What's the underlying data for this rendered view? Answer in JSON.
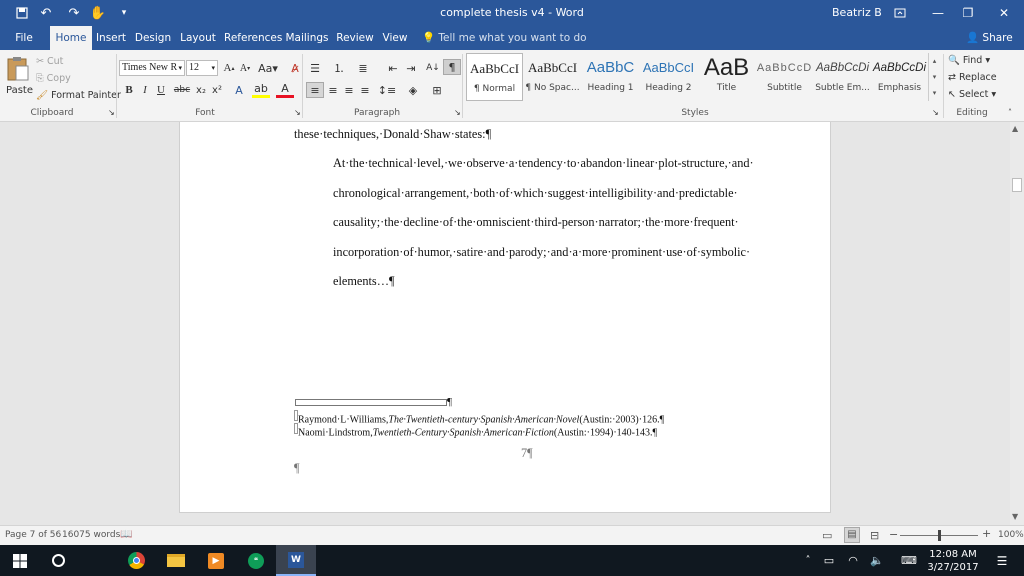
{
  "window": {
    "title": "complete thesis v4  -  Word",
    "user": "Beatriz B"
  },
  "tabs": [
    "File",
    "Home",
    "Insert",
    "Design",
    "Layout",
    "References",
    "Mailings",
    "Review",
    "View"
  ],
  "tell_me": "Tell me what you want to do",
  "share": "Share",
  "clipboard": {
    "paste": "Paste",
    "cut": "Cut",
    "copy": "Copy",
    "format_painter": "Format Painter",
    "label": "Clipboard"
  },
  "font": {
    "name": "Times New R",
    "size": "12",
    "label": "Font"
  },
  "paragraph": {
    "label": "Paragraph"
  },
  "styles": {
    "label": "Styles",
    "items": [
      {
        "preview": "AaBbCcI",
        "name": "¶ Normal"
      },
      {
        "preview": "AaBbCcI",
        "name": "¶ No Spac..."
      },
      {
        "preview": "AaBbC",
        "name": "Heading 1"
      },
      {
        "preview": "AaBbCcI",
        "name": "Heading 2"
      },
      {
        "preview": "AaB",
        "name": "Title"
      },
      {
        "preview": "AaBbCcD",
        "name": "Subtitle"
      },
      {
        "preview": "AaBbCcDi",
        "name": "Subtle Em..."
      },
      {
        "preview": "AaBbCcDi",
        "name": "Emphasis"
      }
    ]
  },
  "editing": {
    "find": "Find",
    "replace": "Replace",
    "select": "Select",
    "label": "Editing"
  },
  "document": {
    "intro": "these·techniques,·Donald·Shaw·states:¶",
    "quote": [
      "At·the·technical·level,·we·observe·a·tendency·to·abandon·linear·plot-structure,·and·",
      "chronological·arrangement,·both·of·which·suggest·intelligibility·and·predictable·",
      "causality;·the·decline·of·the·omniscient·third-person·narrator;·the·more·frequent·",
      "incorporation·of·humor,·satire·and·parody;·and·a·more·prominent·use·of·symbolic·",
      "elements…¶"
    ],
    "fn_sep_mark": "¶",
    "footnote1": {
      "pre": "Raymond·L·Williams,",
      "title": "The·Twentieth-century·Spanish·American·Novel",
      "post": "(Austin:·2003)·126.¶"
    },
    "footnote2": {
      "pre": "Naomi·Lindstrom,",
      "title": "Twentieth-Century·Spanish·American·Fiction",
      "post": "(Austin:·1994)·140-143.¶"
    },
    "page_number": "7¶",
    "trailing_mark": "¶"
  },
  "status": {
    "page": "Page 7 of 56",
    "words": "16075 words",
    "zoom": "100%"
  },
  "clock": {
    "time": "12:08 AM",
    "date": "3/27/2017"
  },
  "colors": {
    "word_blue": "#2b579a",
    "taskbar": "#101820"
  }
}
